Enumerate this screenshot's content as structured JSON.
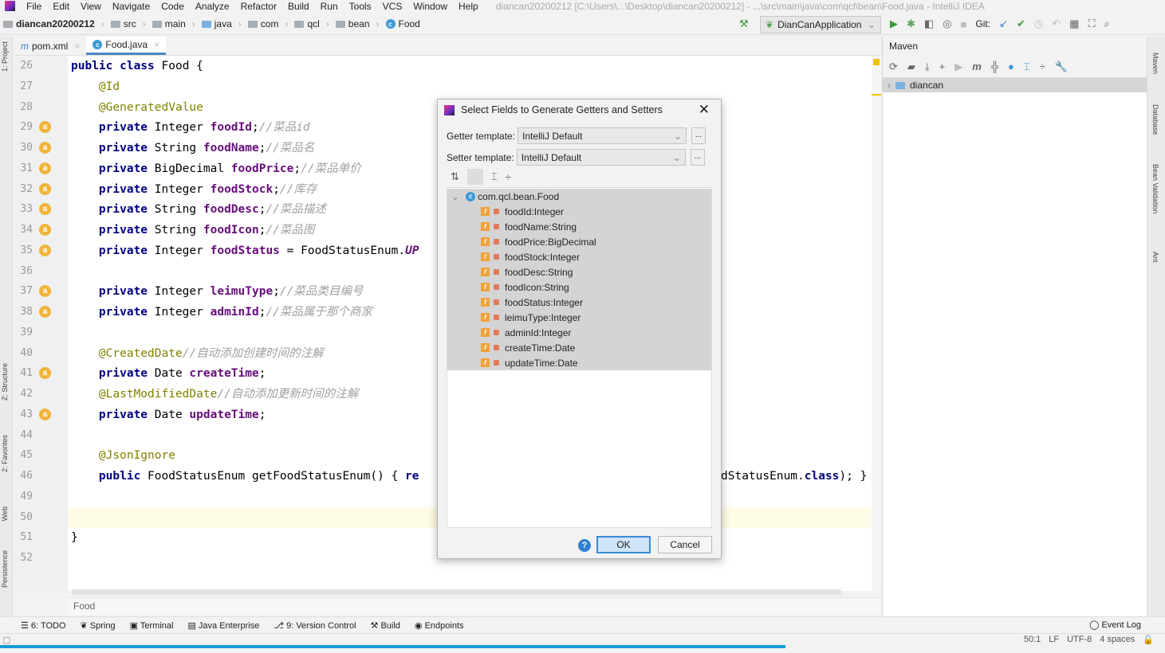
{
  "window": {
    "title": "diancan20200212 [C:\\Users\\...\\Desktop\\diancan20200212] - ...\\src\\main\\java\\com\\qcl\\bean\\Food.java - IntelliJ IDEA"
  },
  "menu": [
    "File",
    "Edit",
    "View",
    "Navigate",
    "Code",
    "Analyze",
    "Refactor",
    "Build",
    "Run",
    "Tools",
    "VCS",
    "Window",
    "Help"
  ],
  "breadcrumb": [
    {
      "label": "diancan20200212",
      "icon": "module"
    },
    {
      "label": "src",
      "icon": "folder"
    },
    {
      "label": "main",
      "icon": "folder"
    },
    {
      "label": "java",
      "icon": "folder-blue"
    },
    {
      "label": "com",
      "icon": "package"
    },
    {
      "label": "qcl",
      "icon": "package"
    },
    {
      "label": "bean",
      "icon": "package"
    },
    {
      "label": "Food",
      "icon": "class"
    }
  ],
  "toolbar": {
    "run_config": "DianCanApplication",
    "git_label": "Git:"
  },
  "tabs": [
    {
      "label": "pom.xml",
      "active": false
    },
    {
      "label": "Food.java",
      "active": true
    }
  ],
  "left_strip": [
    "1: Project",
    "Z: Structure",
    "2: Favorites",
    "Web",
    "Persistence"
  ],
  "right_strip": [
    "Maven",
    "Database",
    "Bean Validation",
    "Ant"
  ],
  "code": [
    {
      "n": "26",
      "tokens": [
        [
          "kw",
          "public class "
        ],
        [
          "tx",
          "Food {"
        ]
      ]
    },
    {
      "n": "27",
      "tokens": [
        [
          "an",
          "    @Id"
        ]
      ]
    },
    {
      "n": "28",
      "tokens": [
        [
          "an",
          "    @GeneratedValue"
        ]
      ]
    },
    {
      "n": "29",
      "mark": true,
      "tokens": [
        [
          "kw",
          "    private "
        ],
        [
          "tx",
          "Integer "
        ],
        [
          "fld",
          "foodId"
        ],
        [
          "tx",
          ";"
        ],
        [
          "cm",
          "//菜品id"
        ]
      ]
    },
    {
      "n": "30",
      "mark": true,
      "tokens": [
        [
          "kw",
          "    private "
        ],
        [
          "tx",
          "String "
        ],
        [
          "fld",
          "foodName"
        ],
        [
          "tx",
          ";"
        ],
        [
          "cm",
          "//菜品名"
        ]
      ]
    },
    {
      "n": "31",
      "mark": true,
      "tokens": [
        [
          "kw",
          "    private "
        ],
        [
          "tx",
          "BigDecimal "
        ],
        [
          "fld",
          "foodPrice"
        ],
        [
          "tx",
          ";"
        ],
        [
          "cm",
          "//菜品单价"
        ]
      ]
    },
    {
      "n": "32",
      "mark": true,
      "tokens": [
        [
          "kw",
          "    private "
        ],
        [
          "tx",
          "Integer "
        ],
        [
          "fld",
          "foodStock"
        ],
        [
          "tx",
          ";"
        ],
        [
          "cm",
          "//库存"
        ]
      ]
    },
    {
      "n": "33",
      "mark": true,
      "tokens": [
        [
          "kw",
          "    private "
        ],
        [
          "tx",
          "String "
        ],
        [
          "fld",
          "foodDesc"
        ],
        [
          "tx",
          ";"
        ],
        [
          "cm",
          "//菜品描述"
        ]
      ]
    },
    {
      "n": "34",
      "mark": true,
      "tokens": [
        [
          "kw",
          "    private "
        ],
        [
          "tx",
          "String "
        ],
        [
          "fld",
          "foodIcon"
        ],
        [
          "tx",
          ";"
        ],
        [
          "cm",
          "//菜品图"
        ]
      ]
    },
    {
      "n": "35",
      "mark": true,
      "tokens": [
        [
          "kw",
          "    private "
        ],
        [
          "tx",
          "Integer "
        ],
        [
          "fld",
          "foodStatus"
        ],
        [
          "tx",
          " = FoodStatusEnum."
        ],
        [
          "st",
          "UP"
        ]
      ]
    },
    {
      "n": "36",
      "tokens": []
    },
    {
      "n": "37",
      "mark": true,
      "tokens": [
        [
          "kw",
          "    private "
        ],
        [
          "tx",
          "Integer "
        ],
        [
          "fld",
          "leimuType"
        ],
        [
          "tx",
          ";"
        ],
        [
          "cm",
          "//菜品类目编号"
        ]
      ]
    },
    {
      "n": "38",
      "mark": true,
      "tokens": [
        [
          "kw",
          "    private "
        ],
        [
          "tx",
          "Integer "
        ],
        [
          "fld",
          "adminId"
        ],
        [
          "tx",
          ";"
        ],
        [
          "cm",
          "//菜品属于那个商家"
        ]
      ]
    },
    {
      "n": "39",
      "tokens": []
    },
    {
      "n": "40",
      "tokens": [
        [
          "an",
          "    @CreatedDate"
        ],
        [
          "cm",
          "//自动添加创建时间的注解"
        ]
      ]
    },
    {
      "n": "41",
      "mark": true,
      "tokens": [
        [
          "kw",
          "    private "
        ],
        [
          "tx",
          "Date "
        ],
        [
          "fld",
          "createTime"
        ],
        [
          "tx",
          ";"
        ]
      ]
    },
    {
      "n": "42",
      "tokens": [
        [
          "an",
          "    @LastModifiedDate"
        ],
        [
          "cm",
          "//自动添加更新时间的注解"
        ]
      ]
    },
    {
      "n": "43",
      "mark": true,
      "tokens": [
        [
          "kw",
          "    private "
        ],
        [
          "tx",
          "Date "
        ],
        [
          "fld",
          "updateTime"
        ],
        [
          "tx",
          ";"
        ]
      ]
    },
    {
      "n": "44",
      "tokens": []
    },
    {
      "n": "45",
      "tokens": [
        [
          "an",
          "    @JsonIgnore"
        ]
      ]
    },
    {
      "n": "46",
      "tokens": [
        [
          "kw",
          "    public "
        ],
        [
          "tx",
          "FoodStatusEnum getFoodStatusEnum() { "
        ],
        [
          "kw",
          "re"
        ]
      ],
      "right": [
        [
          "tx",
          "dStatusEnum."
        ],
        [
          "kw",
          "class"
        ],
        [
          "tx",
          "); }"
        ]
      ]
    },
    {
      "n": "49",
      "tokens": []
    },
    {
      "n": "50",
      "current": true,
      "tokens": []
    },
    {
      "n": "51",
      "tokens": [
        [
          "tx",
          "}"
        ]
      ]
    },
    {
      "n": "52",
      "tokens": []
    }
  ],
  "editor_breadcrumb": "Food",
  "maven": {
    "title": "Maven",
    "project": "diancan"
  },
  "dialog": {
    "title": "Select Fields to Generate Getters and Setters",
    "getter_label": "Getter template:",
    "getter_value": "IntelliJ Default",
    "setter_label": "Setter template:",
    "setter_value": "IntelliJ Default",
    "more": "...",
    "root": "com.qcl.bean.Food",
    "fields": [
      "foodId:Integer",
      "foodName:String",
      "foodPrice:BigDecimal",
      "foodStock:Integer",
      "foodDesc:String",
      "foodIcon:String",
      "foodStatus:Integer",
      "leimuType:Integer",
      "adminId:Integer",
      "createTime:Date",
      "updateTime:Date"
    ],
    "ok": "OK",
    "cancel": "Cancel",
    "help": "?"
  },
  "bottom_tools": [
    "6: TODO",
    "Spring",
    "Terminal",
    "Java Enterprise",
    "9: Version Control",
    "Build",
    "Endpoints"
  ],
  "event_log": "Event Log",
  "status": {
    "position": "50:1",
    "line_sep": "LF",
    "encoding": "UTF-8",
    "indent": "4 spaces"
  },
  "colors": {
    "accent": "#4a88c7",
    "progress": "#1a9ad6",
    "keyword": "#000080",
    "field": "#660e7a",
    "annotation": "#808000",
    "comment": "#a0a0a0"
  }
}
